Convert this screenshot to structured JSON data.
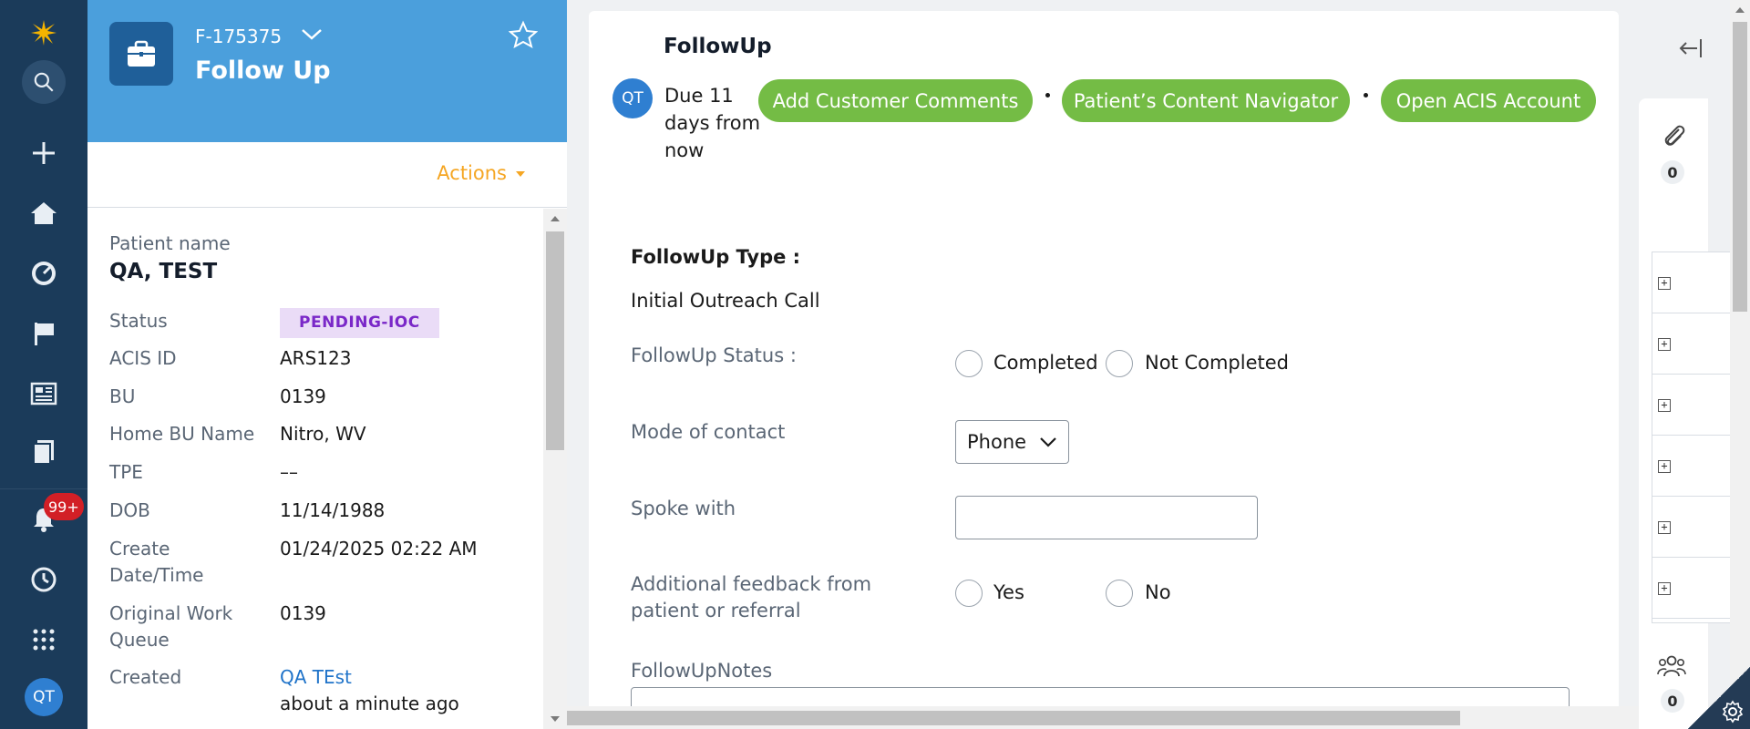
{
  "nav": {
    "notification_count": "99+",
    "user_initials": "QT"
  },
  "case": {
    "id": "F-175375",
    "title": "Follow Up",
    "actions_label": "Actions"
  },
  "patient": {
    "name_label": "Patient name",
    "name": "QA, TEST",
    "fields": [
      {
        "label": "Status",
        "value": "PENDING-IOC"
      },
      {
        "label": "ACIS ID",
        "value": "ARS123"
      },
      {
        "label": "BU",
        "value": "0139"
      },
      {
        "label": "Home BU Name",
        "value": "Nitro, WV"
      },
      {
        "label": "TPE",
        "value": "––"
      },
      {
        "label": "DOB",
        "value": "11/14/1988"
      },
      {
        "label": "Create Date/Time",
        "value": "01/24/2025 02:22 AM"
      },
      {
        "label": "Original Work Queue",
        "value": "0139"
      },
      {
        "label": "Created",
        "value": "QA TEst",
        "sub": "about a minute ago"
      }
    ]
  },
  "followup": {
    "title": "FollowUp",
    "assignee_initials": "QT",
    "due": "Due 11 days from now",
    "buttons": {
      "add_comments": "Add Customer Comments",
      "content_navigator": "Patient’s Content Navigator",
      "open_acis": "Open ACIS Account"
    },
    "type_label": "FollowUp Type :",
    "type_value": "Initial Outreach Call",
    "status_label": "FollowUp Status :",
    "status_options": [
      "Completed",
      "Not Completed"
    ],
    "mode_label": "Mode of contact",
    "mode_value": "Phone",
    "spoke_label": "Spoke with",
    "spoke_value": "",
    "feedback_label": "Additional feedback from patient or referral",
    "feedback_options": [
      "Yes",
      "No"
    ],
    "notes_label": "FollowUpNotes"
  },
  "utilities": {
    "attachments_count": "0",
    "followers_count": "0"
  }
}
